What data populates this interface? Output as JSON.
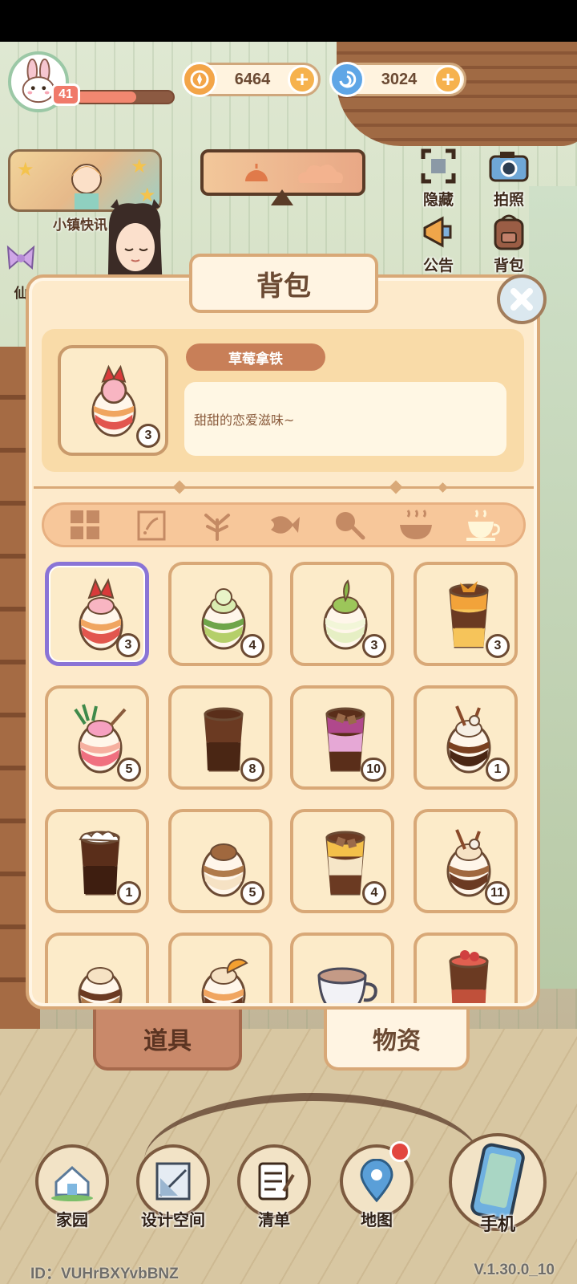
{
  "hud": {
    "level": "41",
    "xp_fraction": 0.62,
    "coins": "6464",
    "gems": "3024",
    "plus": "+"
  },
  "left_widgets": {
    "news_label": "小镇快讯",
    "side_partial_label": "仙"
  },
  "right_buttons": [
    {
      "label": "隐藏",
      "icon": "hide-frame-icon"
    },
    {
      "label": "拍照",
      "icon": "camera-icon"
    },
    {
      "label": "公告",
      "icon": "megaphone-icon"
    },
    {
      "label": "背包",
      "icon": "backpack-icon"
    }
  ],
  "bag": {
    "title": "背包",
    "selected": {
      "name": "草莓拿铁",
      "description": "甜甜的恋爱滋味~",
      "count": "3"
    },
    "categories": [
      {
        "icon": "all-grid-icon"
      },
      {
        "icon": "seed-packet-icon"
      },
      {
        "icon": "plant-sprout-icon"
      },
      {
        "icon": "fish-icon"
      },
      {
        "icon": "drumstick-icon"
      },
      {
        "icon": "hot-bowl-icon"
      },
      {
        "icon": "coffee-cup-icon",
        "active": true
      }
    ],
    "items": [
      {
        "kind": "strawberry-latte",
        "count": "3",
        "selected": true
      },
      {
        "kind": "matcha-drink",
        "count": "4"
      },
      {
        "kind": "matcha-egg-drink",
        "count": "3"
      },
      {
        "kind": "caramel-layer-drink",
        "count": "3"
      },
      {
        "kind": "pineapple-berry-drink",
        "count": "5"
      },
      {
        "kind": "iced-coffee",
        "count": "8"
      },
      {
        "kind": "taro-coffee",
        "count": "10"
      },
      {
        "kind": "cinnamon-cocoa",
        "count": "1"
      },
      {
        "kind": "foam-iced-coffee",
        "count": "1"
      },
      {
        "kind": "milk-coffee-egg",
        "count": "5"
      },
      {
        "kind": "mango-coffee",
        "count": "4"
      },
      {
        "kind": "cinnamon-coffee",
        "count": "11"
      },
      {
        "kind": "plain-coffee",
        "count": ""
      },
      {
        "kind": "orange-coffee",
        "count": ""
      },
      {
        "kind": "latte-cup",
        "count": ""
      },
      {
        "kind": "berry-coffee",
        "count": ""
      }
    ],
    "tabs": {
      "items_label": "道具",
      "materials_label": "物资"
    }
  },
  "nav": [
    {
      "label": "家园",
      "icon": "home-icon"
    },
    {
      "label": "设计空间",
      "icon": "design-ruler-icon"
    },
    {
      "label": "清单",
      "icon": "checklist-icon"
    },
    {
      "label": "地图",
      "icon": "map-pin-icon",
      "badge": true
    },
    {
      "label": "手机",
      "icon": "phone-icon"
    }
  ],
  "footer": {
    "id_text": "ID：VUHrBXYvbBNZ",
    "version": "V.1.30.0_10"
  },
  "colors": {
    "panel": "#fdeacb",
    "border": "#d8a877",
    "selected_border": "#8a74d6",
    "accent_orange": "#f6b24e",
    "name_pill": "#c87f58"
  }
}
